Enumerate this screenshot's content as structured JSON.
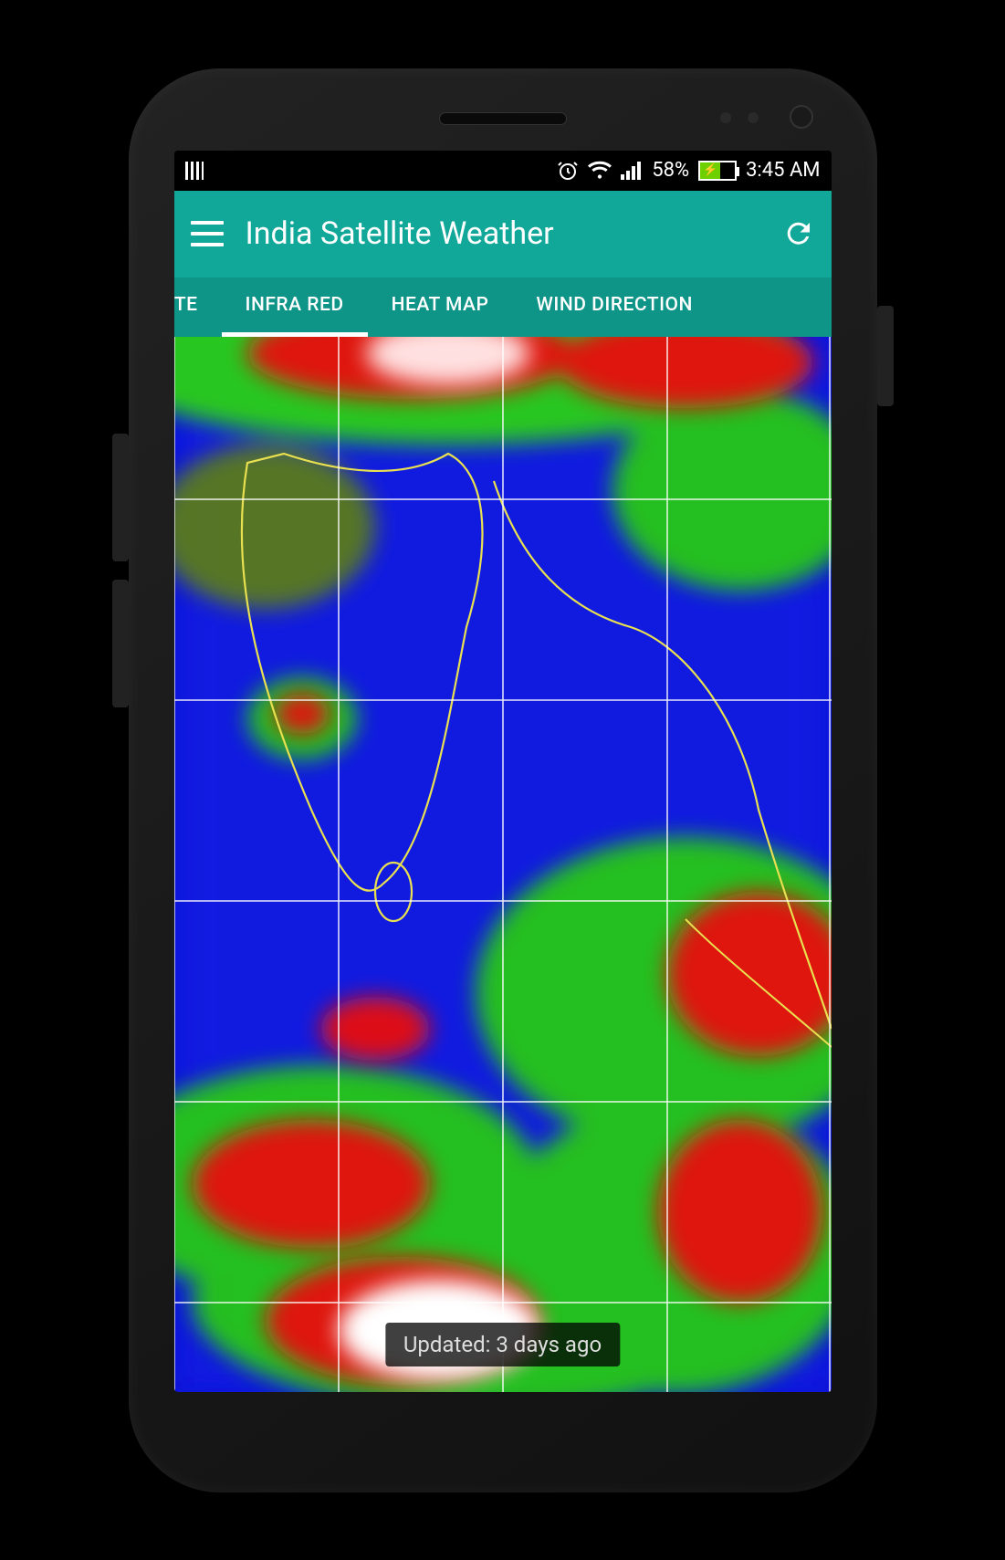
{
  "status": {
    "battery_pct": "58%",
    "time": "3:45 AM"
  },
  "app": {
    "title": "India Satellite Weather"
  },
  "tabs": [
    {
      "id": "composite",
      "label": "OSITE",
      "full_label": "COMPOSITE",
      "active": false
    },
    {
      "id": "infrared",
      "label": "INFRA RED",
      "active": true
    },
    {
      "id": "heatmap",
      "label": "HEAT MAP",
      "active": false
    },
    {
      "id": "wind",
      "label": "WIND DIRECTION",
      "active": false
    }
  ],
  "map": {
    "toast": "Updated: 3 days ago"
  }
}
